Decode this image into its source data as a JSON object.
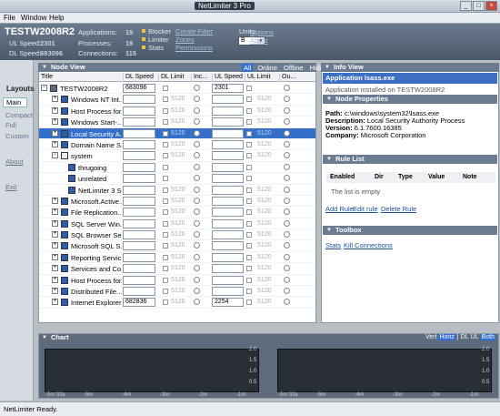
{
  "window": {
    "title": "NetLimiter 3 Pro"
  },
  "menu": [
    "File",
    "Window",
    "Help"
  ],
  "header": {
    "host": "TESTW2008R2",
    "ul_label": "UL Speed:",
    "ul_value": "2301",
    "dl_label": "DL Speed:",
    "dl_value": "683096",
    "apps_label": "Applications:",
    "apps_value": "19",
    "proc_label": "Processes:",
    "proc_value": "19",
    "conn_label": "Connections:",
    "conn_value": "115",
    "toggles": [
      "Blocker",
      "Limiter",
      "Stats"
    ],
    "links": [
      "Create Filter",
      "Zones",
      "Permissions"
    ],
    "units_label": "Units:",
    "units_value": "B",
    "options": "Options",
    "about": "About"
  },
  "leftnav": {
    "heading": "Layouts",
    "items": [
      "Main",
      "Compact",
      "Full",
      "Custom"
    ],
    "about": "About",
    "exit": "Exit"
  },
  "nodeview": {
    "title": "Node View",
    "filters": [
      "All",
      "Online",
      "Offline",
      "Hidden"
    ],
    "columns": [
      "Title",
      "DL Speed",
      "DL Limit",
      "Inc...",
      "UL Speed",
      "UL Limit",
      "Ou..."
    ],
    "limit_value": "5120",
    "rows": [
      {
        "name": "TESTW2008R2",
        "dl": "683096",
        "ul": "2301",
        "lim": ""
      },
      {
        "name": "Windows NT Int...",
        "dl": "",
        "ul": "",
        "lim": "5120"
      },
      {
        "name": "Host Process for...",
        "dl": "",
        "ul": "",
        "lim": "5120"
      },
      {
        "name": "Windows Start-...",
        "dl": "",
        "ul": "",
        "lim": "5120"
      },
      {
        "name": "Local Security A...",
        "dl": "",
        "ul": "",
        "lim": "5120"
      },
      {
        "name": "Domain Name S...",
        "dl": "",
        "ul": "",
        "lim": "5120"
      },
      {
        "name": "system",
        "dl": "",
        "ul": "",
        "lim": "5120"
      },
      {
        "name": "thrugoing",
        "dl": "",
        "ul": "",
        "lim": ""
      },
      {
        "name": "unrelated",
        "dl": "",
        "ul": "",
        "lim": ""
      },
      {
        "name": "NetLimiter 3 Ser...",
        "dl": "",
        "ul": "",
        "lim": "5120"
      },
      {
        "name": "Microsoft.Active...",
        "dl": "",
        "ul": "",
        "lim": "5120"
      },
      {
        "name": "File Replication...",
        "dl": "",
        "ul": "",
        "lim": "5120"
      },
      {
        "name": "SQL Server Win...",
        "dl": "",
        "ul": "",
        "lim": "5120"
      },
      {
        "name": "SQL Browser Se...",
        "dl": "",
        "ul": "",
        "lim": "5120"
      },
      {
        "name": "Microsoft SQL S...",
        "dl": "",
        "ul": "",
        "lim": "5120"
      },
      {
        "name": "Reporting Servic...",
        "dl": "",
        "ul": "",
        "lim": "5120"
      },
      {
        "name": "Services and Co...",
        "dl": "",
        "ul": "",
        "lim": "5120"
      },
      {
        "name": "Host Process for...",
        "dl": "",
        "ul": "",
        "lim": "5120"
      },
      {
        "name": "Distributed File...",
        "dl": "",
        "ul": "",
        "lim": "5120"
      },
      {
        "name": "Internet Explorer",
        "dl": "682836",
        "ul": "2254",
        "lim": "5120"
      }
    ]
  },
  "infoview": {
    "title": "Info View",
    "app_title": "Application lsass.exe",
    "installed": "Application installed on TESTW2008R2",
    "node_props_title": "Node Properties",
    "path_label": "Path:",
    "path": "c:\\windows\\system32\\lsass.exe",
    "desc_label": "Description:",
    "desc": "Local Security Authority Process",
    "ver_label": "Version:",
    "ver": "6.1.7600.16385",
    "comp_label": "Company:",
    "comp": "Microsoft Corporation",
    "rulelist_title": "Rule List",
    "rule_cols": [
      "Enabled",
      "Dir",
      "Type",
      "Value",
      "Note"
    ],
    "rule_empty": "The list is empty",
    "rule_actions": [
      "Add Rule",
      "Edit rule",
      "Delete Rule"
    ],
    "toolbox_title": "Toolbox",
    "toolbox_links": [
      "Stats",
      "Kill Connections"
    ]
  },
  "chart": {
    "title": "Chart",
    "controls": [
      "Vert",
      "Horiz",
      "|",
      "DL",
      "UL",
      "Both"
    ],
    "x_ticks": [
      "-5m:33s",
      "-5m",
      "-4m",
      "-3m",
      "-2m",
      "-1m"
    ],
    "y_ticks": [
      "2.0",
      "1.5",
      "1.0",
      "0.5"
    ]
  },
  "status": "NetLimiter Ready."
}
